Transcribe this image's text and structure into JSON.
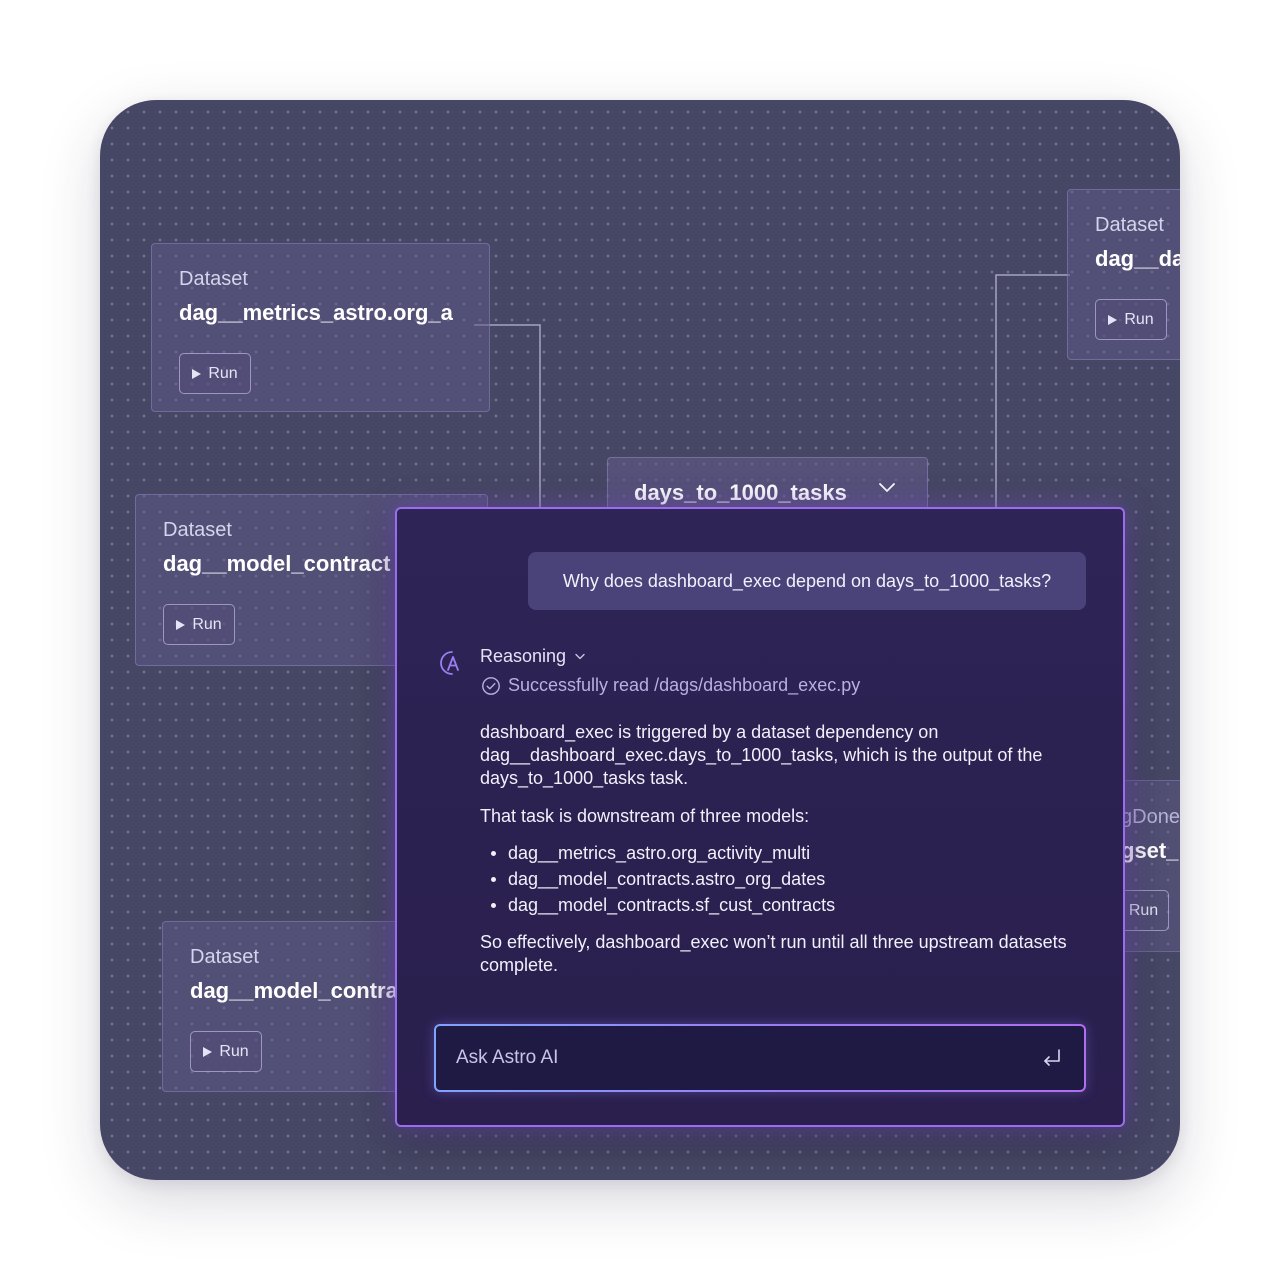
{
  "canvas": {
    "nodes": [
      {
        "kind": "Dataset",
        "name": "dag__metrics_astro.org_a",
        "run_label": "Run"
      },
      {
        "kind": "Dataset",
        "name": "dag__model_contract",
        "run_label": "Run"
      },
      {
        "kind": "Dataset",
        "name": "dag__model_contra",
        "run_label": "Run"
      },
      {
        "kind": "Dataset",
        "name": "dag__da",
        "run_label": "Run"
      }
    ],
    "partial_node": {
      "label": "gDone",
      "name": "gset_",
      "run_label": "Run"
    },
    "task_node": {
      "name": "days_to_1000_tasks"
    }
  },
  "chat": {
    "question": "Why does dashboard_exec depend on days_to_1000_tasks?",
    "reasoning_label": "Reasoning",
    "status": "Successfully read /dags/dashboard_exec.py",
    "answer_p1": "dashboard_exec is triggered by a dataset dependency on dag__dashboard_exec.days_to_1000_tasks, which is the output of the days_to_1000_tasks task.",
    "answer_p2": "That task is downstream of three models:",
    "models": [
      "dag__metrics_astro.org_activity_multi",
      "dag__model_contracts.astro_org_dates",
      "dag__model_contracts.sf_cust_contracts"
    ],
    "answer_p3": "So effectively, dashboard_exec won’t run until all three upstream datasets complete.",
    "input": {
      "placeholder": "Ask Astro AI",
      "value": ""
    }
  },
  "colors": {
    "canvas_bg": "#464764",
    "chat_bg": "#2c2252",
    "chat_border": "#9a6cf0",
    "question_bg": "#4a4379",
    "status_text": "#b9b0e0"
  },
  "icons": [
    "play-icon",
    "chevron-down-icon",
    "astro-ai-icon",
    "check-circle-icon",
    "enter-icon"
  ]
}
